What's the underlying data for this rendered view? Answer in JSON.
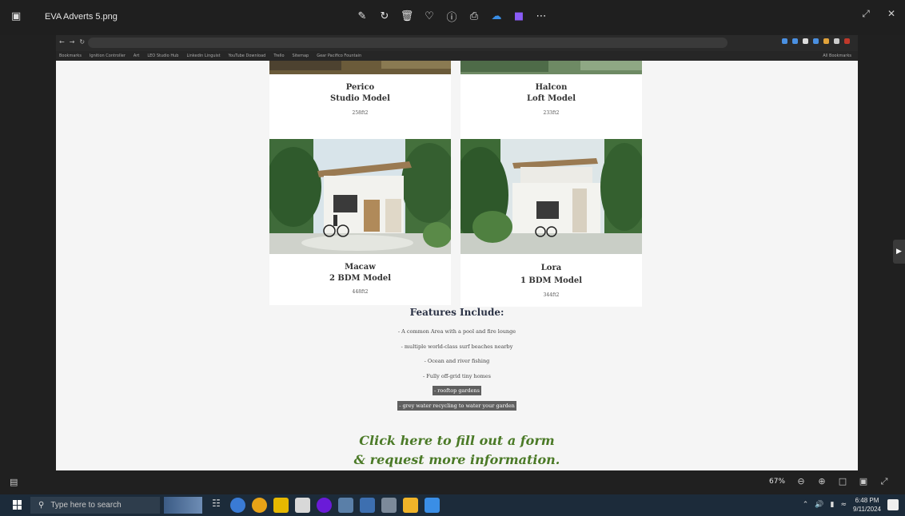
{
  "viewer": {
    "filename": "EVA Adverts 5.png",
    "zoom": "67%"
  },
  "browser": {
    "url": "",
    "bookmarks": [
      "Bookmarks",
      "Ignition Controller",
      "Art",
      "LEO Studio Hub",
      "Linkedin Linguist",
      "YouTube Download",
      "Trello",
      "Sitemap",
      "Gear Pacifico Fountain"
    ],
    "other_bookmarks": "All Bookmarks"
  },
  "cards": [
    {
      "name_line1": "Perico",
      "name_line2": "Studio Model",
      "size": "258ft2"
    },
    {
      "name_line1": "Halcon",
      "name_line2": "Loft Model",
      "size": "233ft2"
    },
    {
      "name_line1": "Macaw",
      "name_line2": "2 BDM Model",
      "size": "448ft2"
    },
    {
      "name_line1": "Lora",
      "name_line2": "1 BDM Model",
      "size": "344ft2"
    }
  ],
  "features": {
    "title": "Features Include:",
    "items": [
      "- A common Area with a pool and fire lounge",
      "- multiple world-class surf beaches nearby",
      "- Ocean and river fishing",
      "- Fully off-grid tiny homes",
      "- rooftop gardens",
      "- grey water recycling to water your garden"
    ]
  },
  "cta": {
    "line1": "Click here to fill out a form",
    "line2": "& request more information."
  },
  "taskbar": {
    "search_placeholder": "Type here to search",
    "time": "6:48 PM",
    "date": "9/11/2024"
  }
}
